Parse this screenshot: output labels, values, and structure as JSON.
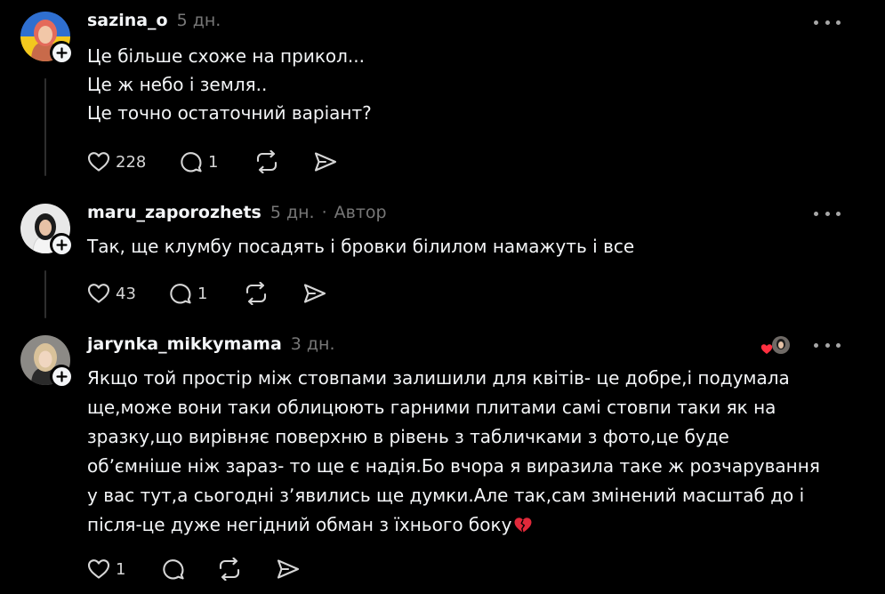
{
  "comments": [
    {
      "username": "sazina_o",
      "time": "5 дн.",
      "lines": [
        "Це більше схоже на прикол...",
        "Це ж небо і земля..",
        "Це точно остаточний варіант?"
      ],
      "likes": "228",
      "replies": "1"
    },
    {
      "username": "maru_zaporozhets",
      "time": "5 дн.",
      "separator": "·",
      "author_label": "Автор",
      "lines": [
        "Так, ще клумбу посадять і бровки білилом намажуть і все"
      ],
      "likes": "43",
      "replies": "1"
    },
    {
      "username": "jarynka_mikkymama",
      "time": "3 дн.",
      "lines": [
        "Якщо той простір між стовпами залишили для квітів- це добре,і подумала",
        "ще,може вони таки облицюють гарними плитами самі стовпи таки як на",
        "зразку,що вирівняє поверхню в рівень з табличками з фото,це буде",
        "обʼємніше ніж зараз- то ще є надія.Бо вчора я виразила таке ж розчарування",
        "у вас тут,а сьогодні зʼявились ще думки.Але так,сам змінений масштаб до і",
        "після-це дуже негідний обман з їхнього боку"
      ],
      "likes": "1"
    }
  ],
  "icons": {
    "like": "heart-outline-icon",
    "reply": "comment-bubble-icon",
    "repost": "repost-icon",
    "share": "send-icon",
    "more": "more-horizontal-icon",
    "follow": "plus-icon",
    "broken_heart": "broken-heart-emoji",
    "liked_by_author": "liked-by-author-icon"
  },
  "colors": {
    "background": "#000000",
    "text_primary": "#f3f5f7",
    "text_secondary": "#777777",
    "icon": "#d6d6d6",
    "heart_red": "#ff3040"
  }
}
